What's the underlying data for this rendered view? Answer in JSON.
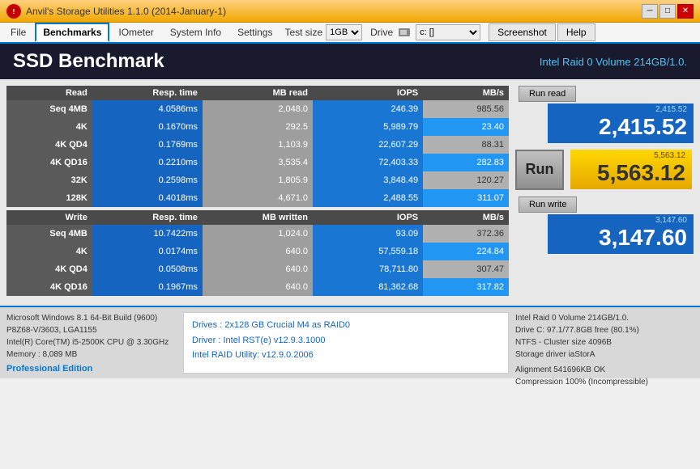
{
  "titlebar": {
    "title": "Anvil's Storage Utilities 1.1.0 (2014-January-1)",
    "icon": "A",
    "minimize": "─",
    "maximize": "□",
    "close": "✕"
  },
  "menubar": {
    "file": "File",
    "benchmarks": "Benchmarks",
    "iometer": "IOmeter",
    "sysinfo": "System Info",
    "settings": "Settings",
    "testsize_label": "Test size",
    "testsize_value": "1GB",
    "drive_label": "Drive",
    "drive_value": "c: []",
    "screenshot": "Screenshot",
    "help": "Help"
  },
  "header": {
    "title": "SSD Benchmark",
    "drive_info": "Intel Raid 0 Volume 214GB/1.0."
  },
  "read_table": {
    "headers": [
      "Read",
      "Resp. time",
      "MB read",
      "IOPS",
      "MB/s"
    ],
    "rows": [
      {
        "label": "Seq 4MB",
        "resp": "4.0586ms",
        "mb": "2,048.0",
        "iops": "246.39",
        "mbs": "985.56",
        "highlight": false
      },
      {
        "label": "4K",
        "resp": "0.1670ms",
        "mb": "292.5",
        "iops": "5,989.79",
        "mbs": "23.40",
        "highlight": true
      },
      {
        "label": "4K QD4",
        "resp": "0.1769ms",
        "mb": "1,103.9",
        "iops": "22,607.29",
        "mbs": "88.31",
        "highlight": false
      },
      {
        "label": "4K QD16",
        "resp": "0.2210ms",
        "mb": "3,535.4",
        "iops": "72,403.33",
        "mbs": "282.83",
        "highlight": true
      },
      {
        "label": "32K",
        "resp": "0.2598ms",
        "mb": "1,805.9",
        "iops": "3,848.49",
        "mbs": "120.27",
        "highlight": false
      },
      {
        "label": "128K",
        "resp": "0.4018ms",
        "mb": "4,671.0",
        "iops": "2,488.55",
        "mbs": "311.07",
        "highlight": true
      }
    ]
  },
  "write_table": {
    "headers": [
      "Write",
      "Resp. time",
      "MB written",
      "IOPS",
      "MB/s"
    ],
    "rows": [
      {
        "label": "Seq 4MB",
        "resp": "10.7422ms",
        "mb": "1,024.0",
        "iops": "93.09",
        "mbs": "372.36",
        "highlight": false
      },
      {
        "label": "4K",
        "resp": "0.0174ms",
        "mb": "640.0",
        "iops": "57,559.18",
        "mbs": "224.84",
        "highlight": true
      },
      {
        "label": "4K QD4",
        "resp": "0.0508ms",
        "mb": "640.0",
        "iops": "78,711.80",
        "mbs": "307.47",
        "highlight": false
      },
      {
        "label": "4K QD16",
        "resp": "0.1967ms",
        "mb": "640.0",
        "iops": "81,362.68",
        "mbs": "317.82",
        "highlight": true
      }
    ]
  },
  "scores": {
    "read_score_sub": "2,415.52",
    "read_score_main": "2,415.52",
    "run_read": "Run read",
    "total_score_sub": "5,563.12",
    "total_score_main": "5,563.12",
    "run_label": "Run",
    "write_score_sub": "3,147.60",
    "write_score_main": "3,147.60",
    "run_write": "Run write"
  },
  "bottom": {
    "sys_line1": "Microsoft Windows 8.1 64-Bit Build (9600)",
    "sys_line2": "P8Z68-V/3603, LGA1155",
    "sys_line3": "Intel(R) Core(TM) i5-2500K CPU @ 3.30GHz",
    "sys_line4": "Memory : 8,089 MB",
    "professional": "Professional Edition",
    "drives_line1": "Drives : 2x128 GB Crucial M4 as RAID0",
    "drives_line2": "Driver : Intel RST(e) v12.9.3.1000",
    "drives_line3": "Intel RAID Utility: v12.9.0.2006",
    "info_line1": "Intel Raid 0 Volume 214GB/1.0.",
    "info_line2": "Drive C: 97.1/77.8GB free (80.1%)",
    "info_line3": "NTFS - Cluster size 4096B",
    "info_line4": "Storage driver  iaStorA",
    "info_line5": "",
    "info_line6": "Alignment 541696KB OK",
    "info_line7": "Compression 100% (Incompressible)"
  }
}
